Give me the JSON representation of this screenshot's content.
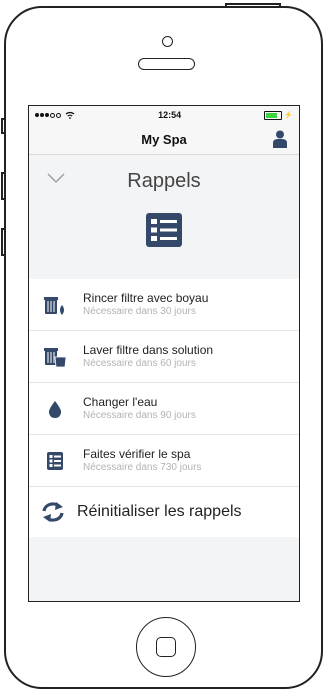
{
  "status_bar": {
    "time": "12:54"
  },
  "nav": {
    "title": "My Spa"
  },
  "section": {
    "title": "Rappels"
  },
  "reminders": [
    {
      "title": "Rincer filtre avec boyau",
      "subtitle": "Nécessaire dans 30 jours",
      "icon": "filter-rinse-icon"
    },
    {
      "title": "Laver filtre dans solution",
      "subtitle": "Nécessaire dans 60 jours",
      "icon": "filter-wash-icon"
    },
    {
      "title": "Changer l'eau",
      "subtitle": "Nécessaire dans 90 jours",
      "icon": "water-drop-icon"
    },
    {
      "title": "Faites vérifier le spa",
      "subtitle": "Nécessaire dans 730 jours",
      "icon": "checklist-icon"
    }
  ],
  "reset": {
    "label": "Réinitialiser les rappels",
    "icon": "refresh-icon"
  },
  "colors": {
    "accent": "#34496a",
    "subtext": "#b3b3b3"
  }
}
